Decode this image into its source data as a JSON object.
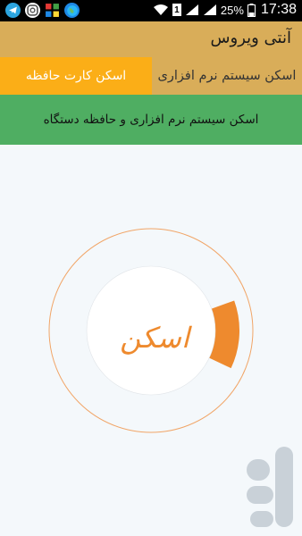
{
  "status_bar": {
    "battery": "25%",
    "sim_slot": "1",
    "time": "17:38",
    "notification_icons": [
      "telegram-icon",
      "instagram-icon",
      "network-icon",
      "globe-icon"
    ]
  },
  "app": {
    "title": "آنتی ویروس"
  },
  "tabs": [
    {
      "label": "اسکن سیستم نرم افزاری",
      "selected": false
    },
    {
      "label": "اسکن کارت حافظه",
      "selected": true
    }
  ],
  "action_button": {
    "label": "اسکن سیستم نرم افزاری و حافظه دستگاه"
  },
  "scan_widget": {
    "label": "اسکن",
    "progress_fraction": 0.125
  },
  "colors": {
    "app_bar": "#d9ad59",
    "selected_tab": "#fbae17",
    "action_button": "#4fae62",
    "accent": "#ee8a2e",
    "background": "#f4f8fb"
  }
}
